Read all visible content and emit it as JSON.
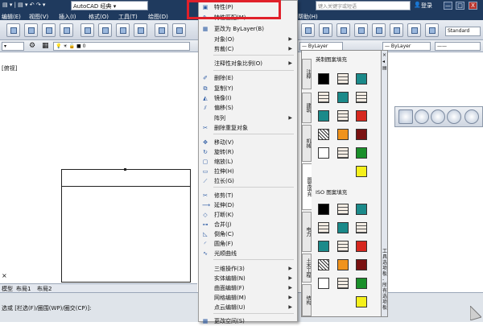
{
  "titlebar": {
    "app": "AutoCAD 经典",
    "search_placeholder": "键入关键字或短语",
    "login": "登录",
    "close": "X",
    "minimize": "—",
    "maximize": "□"
  },
  "menubar": [
    "编辑(E)",
    "视图(V)",
    "插入(I)",
    "格式(O)",
    "工具(T)",
    "绘图(D)",
    "帮助(H)"
  ],
  "toolbar2": {
    "layer_value": "0",
    "linetype": "ByLayer",
    "lineweight": "ByLayer",
    "style": "Standard"
  },
  "drawing": {
    "corner_label": "[俯视]"
  },
  "layout_tabs": [
    "模型",
    "布局1",
    "布局2"
  ],
  "command_line": "选或 [栏选(F)/圈围(WP)/圈交(CP)]:",
  "context_menu": {
    "items": [
      {
        "label": "特性(P)",
        "icon": "props"
      },
      {
        "label": "特性匹配(M)",
        "icon": "match"
      },
      {
        "label": "更改为 ByLayer(B)",
        "icon": "bylayer"
      },
      {
        "label": "对象(O)",
        "sub": true
      },
      {
        "label": "剪裁(C)",
        "sub": true
      },
      {
        "label": "注释性对象比例(O)",
        "sub": true
      },
      {
        "label": "删除(E)",
        "icon": "erase"
      },
      {
        "label": "复制(Y)",
        "icon": "copy"
      },
      {
        "label": "镜像(I)",
        "icon": "mirror"
      },
      {
        "label": "偏移(S)",
        "icon": "offset"
      },
      {
        "label": "阵列",
        "sub": true
      },
      {
        "label": "删除重复对象",
        "icon": "overkill"
      },
      {
        "label": "移动(V)",
        "icon": "move"
      },
      {
        "label": "旋转(R)",
        "icon": "rotate"
      },
      {
        "label": "缩放(L)",
        "icon": "scale"
      },
      {
        "label": "拉伸(H)",
        "icon": "stretch"
      },
      {
        "label": "拉长(G)",
        "icon": "lengthen"
      },
      {
        "label": "修剪(T)",
        "icon": "trim"
      },
      {
        "label": "延伸(D)",
        "icon": "extend"
      },
      {
        "label": "打断(K)",
        "icon": "break"
      },
      {
        "label": "合并(J)",
        "icon": "join"
      },
      {
        "label": "倒角(C)",
        "icon": "chamfer"
      },
      {
        "label": "圆角(F)",
        "icon": "fillet"
      },
      {
        "label": "光顺曲线",
        "icon": "blend"
      },
      {
        "label": "三维操作(3)",
        "sub": true
      },
      {
        "label": "实体编辑(N)",
        "sub": true
      },
      {
        "label": "曲面编辑(F)",
        "sub": true
      },
      {
        "label": "网格编辑(M)",
        "sub": true
      },
      {
        "label": "点云编辑(U)",
        "sub": true
      },
      {
        "label": "更改空间(S)",
        "icon": "chspace"
      }
    ]
  },
  "palette": {
    "title": "工具选项板 - 所有选项板",
    "tabs": [
      "注释",
      "建筑",
      "机械",
      "图案填充",
      "电力",
      "土木工程",
      "结构"
    ],
    "active_tab": "图案填充",
    "section1": "英制图案填充",
    "section2": "ISO 图案填充",
    "colors": {
      "black": "#000000",
      "teal": "#1b8a8a",
      "red": "#d6281f",
      "maroon": "#7a1212",
      "green": "#1a8f2a",
      "orange": "#f0931d",
      "yellow": "#f5f01b",
      "brick": "#f3ece3"
    }
  }
}
